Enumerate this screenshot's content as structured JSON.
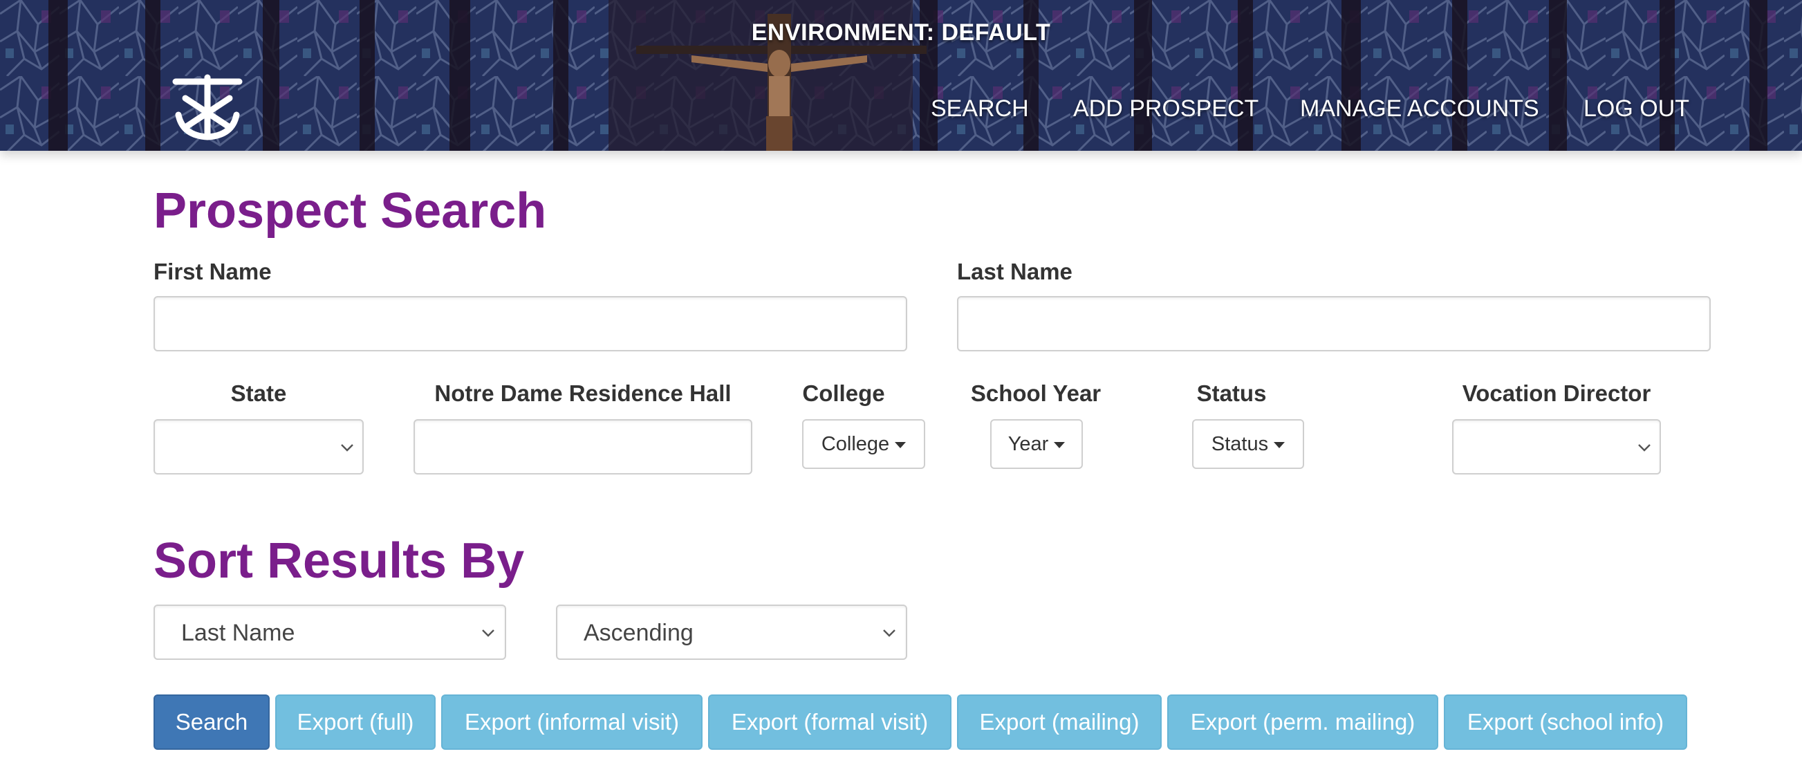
{
  "header": {
    "environment_label": "ENVIRONMENT: DEFAULT",
    "logo_icon": "cross-anchor-logo-icon",
    "nav": [
      "SEARCH",
      "ADD PROSPECT",
      "MANAGE ACCOUNTS",
      "LOG OUT"
    ]
  },
  "search": {
    "title": "Prospect Search",
    "first_name_label": "First Name",
    "first_name_value": "",
    "last_name_label": "Last Name",
    "last_name_value": "",
    "state_label": "State",
    "state_value": "",
    "residence_hall_label": "Notre Dame Residence Hall",
    "residence_hall_value": "",
    "college_label": "College",
    "college_button": "College",
    "school_year_label": "School Year",
    "school_year_button": "Year",
    "status_label": "Status",
    "status_button": "Status",
    "vocation_director_label": "Vocation Director",
    "vocation_director_value": ""
  },
  "sort": {
    "title": "Sort Results By",
    "field_value": "Last Name",
    "order_value": "Ascending"
  },
  "actions": {
    "search": "Search",
    "export_full": "Export (full)",
    "export_informal_visit": "Export (informal visit)",
    "export_formal_visit": "Export (formal visit)",
    "export_mailing": "Export (mailing)",
    "export_perm_mailing": "Export (perm. mailing)",
    "export_school_info": "Export (school info)"
  },
  "colors": {
    "heading": "#7a1e8b",
    "primary_button": "#3f77b5",
    "info_button": "#72bfdf"
  }
}
